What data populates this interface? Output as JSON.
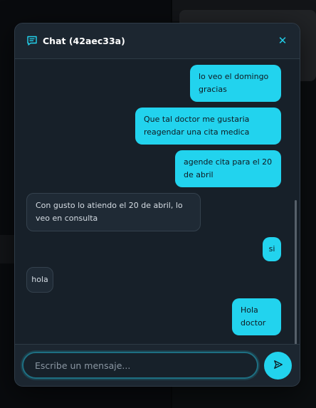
{
  "header": {
    "title": "Chat (42aec33a)",
    "icon": "chat-icon",
    "close_label": "✕"
  },
  "messages": [
    {
      "from": "me",
      "text": "lo veo el domingo gracias"
    },
    {
      "from": "me",
      "text": "Que tal doctor me gustaria reagendar una cita medica"
    },
    {
      "from": "me",
      "text": "agende cita para el 20 de abril"
    },
    {
      "from": "other",
      "text": "Con gusto lo atiendo el 20 de abril, lo veo en consulta"
    },
    {
      "from": "me",
      "text": "si"
    },
    {
      "from": "other",
      "text": "hola"
    },
    {
      "from": "me",
      "text": "Hola doctor"
    }
  ],
  "composer": {
    "placeholder": "Escribe un mensaje...",
    "value": "",
    "send_icon": "send-icon"
  },
  "colors": {
    "accent": "#22d3ee",
    "panel": "#1a222b",
    "incoming_bubble": "#1f2a35"
  }
}
